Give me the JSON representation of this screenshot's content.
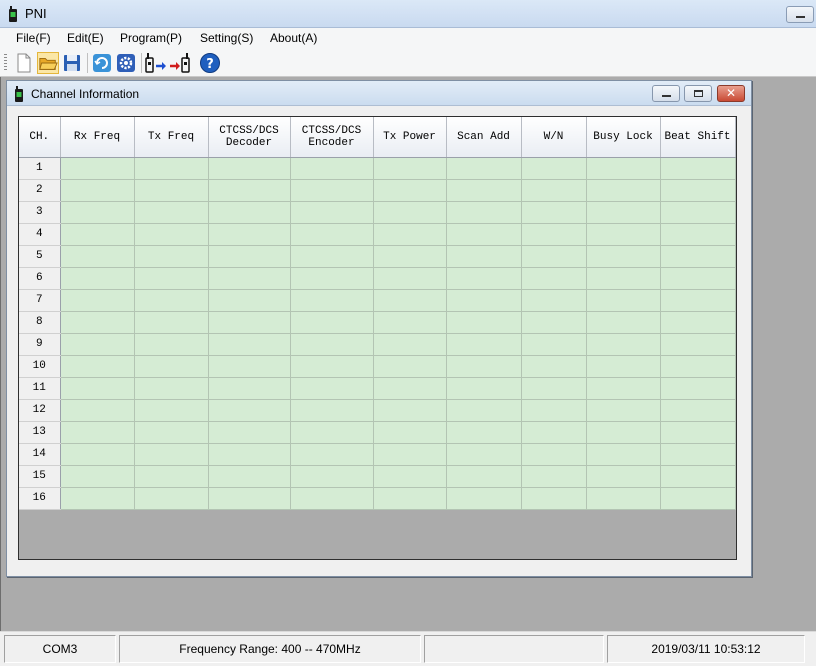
{
  "app": {
    "title": "PNI",
    "icon": "radio-icon"
  },
  "menu": [
    "File(F)",
    "Edit(E)",
    "Program(P)",
    "Setting(S)",
    "About(A)"
  ],
  "toolbar": {
    "buttons": [
      {
        "name": "new-file-icon"
      },
      {
        "name": "open-folder-icon"
      },
      {
        "name": "save-icon"
      },
      {
        "name": "refresh-icon"
      },
      {
        "name": "settings-icon"
      },
      {
        "name": "radio-transfer-icon"
      },
      {
        "name": "help-icon"
      }
    ]
  },
  "child_window": {
    "title": "Channel Information",
    "controls": [
      "minimize",
      "maximize",
      "close"
    ]
  },
  "grid": {
    "columns": [
      "CH.",
      "Rx Freq",
      "Tx Freq",
      "CTCSS/DCS Decoder",
      "CTCSS/DCS Encoder",
      "Tx Power",
      "Scan Add",
      "W/N",
      "Busy Lock",
      "Beat Shift"
    ],
    "rows": [
      "1",
      "2",
      "3",
      "4",
      "5",
      "6",
      "7",
      "8",
      "9",
      "10",
      "11",
      "12",
      "13",
      "14",
      "15",
      "16"
    ]
  },
  "status": {
    "port": "COM3",
    "range": "Frequency Range: 400 -- 470MHz",
    "empty": "",
    "datetime": "2019/03/11 10:53:12"
  },
  "colors": {
    "cell_green": "#d5ecd4",
    "mdi_gray": "#ababab",
    "help_blue": "#1f5fbf"
  }
}
